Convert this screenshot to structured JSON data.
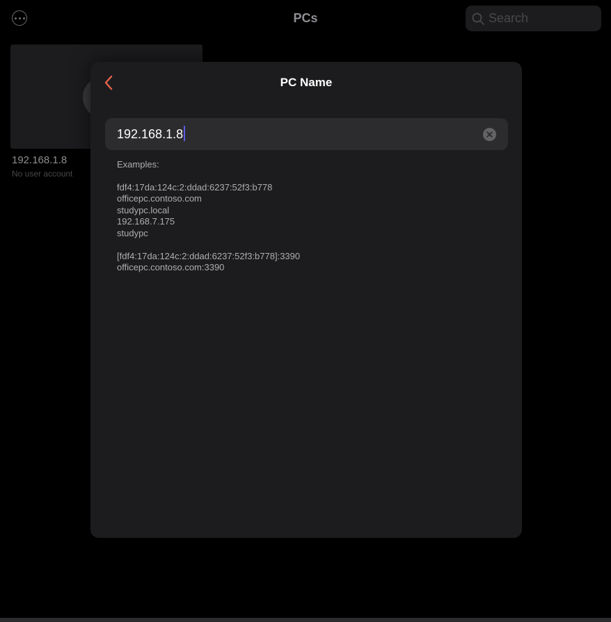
{
  "background": {
    "title": "PCs",
    "more_icon": "ellipsis-circle-icon",
    "search": {
      "placeholder": "Search",
      "icon": "magnifying-glass-icon"
    },
    "pcs": [
      {
        "name": "192.168.1.8",
        "account": "No user account"
      }
    ]
  },
  "modal": {
    "title": "PC Name",
    "back_icon": "chevron-left-icon",
    "input": {
      "value": "192.168.1.8",
      "clear_icon": "clear-circle-icon"
    },
    "examples": {
      "heading": "Examples:",
      "groups": [
        [
          "fdf4:17da:124c:2:ddad:6237:52f3:b778",
          "officepc.contoso.com",
          "studypc.local",
          "192.168.7.175",
          "studypc"
        ],
        [
          "[fdf4:17da:124c:2:ddad:6237:52f3:b778]:3390",
          "officepc.contoso.com:3390"
        ]
      ]
    }
  },
  "colors": {
    "accent": "#e8634a",
    "caret": "#5e5ce6",
    "sheet": "#1c1c1e",
    "field": "#2c2c2e"
  }
}
